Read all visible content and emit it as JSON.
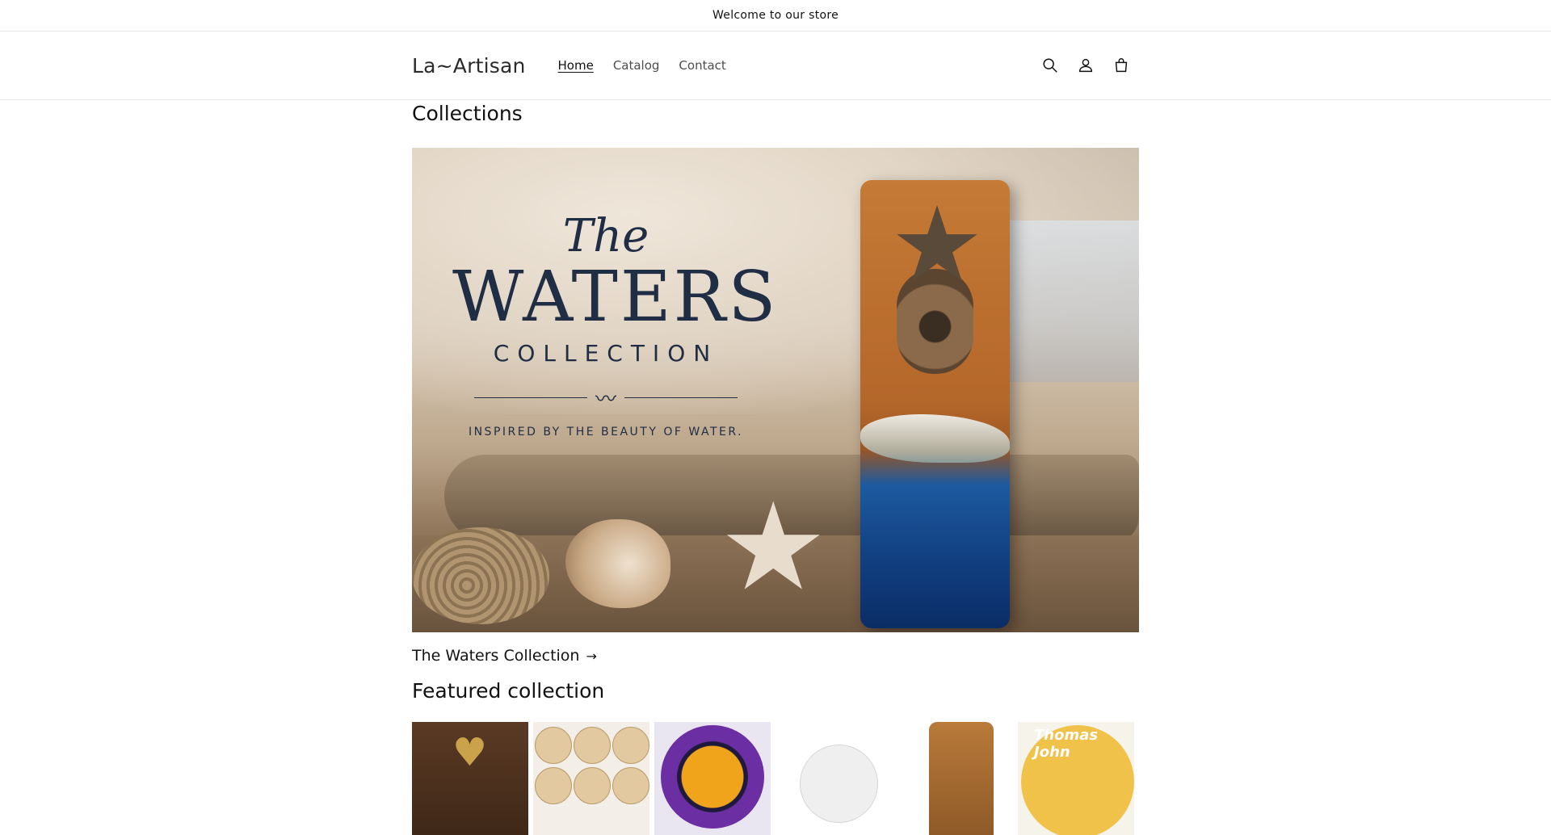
{
  "announcement": {
    "text": "Welcome to our store"
  },
  "header": {
    "logo": "La~Artisan",
    "nav": [
      {
        "label": "Home",
        "active": true
      },
      {
        "label": "Catalog",
        "active": false
      },
      {
        "label": "Contact",
        "active": false
      }
    ],
    "icons": [
      "search-icon",
      "account-icon",
      "cart-icon"
    ]
  },
  "collections": {
    "title": "Collections",
    "hero": {
      "the": "The",
      "waters": "WATERS",
      "collection": "COLLECTION",
      "tagline": "INSPIRED BY THE BEAUTY OF WATER."
    },
    "link_label": "The Waters Collection",
    "link_arrow": "→"
  },
  "featured": {
    "title": "Featured collection",
    "product_6_text": "Thomas John"
  },
  "colors": {
    "text": "#121212",
    "border": "#e8e8e8",
    "hero_ink": "#1f2d45"
  }
}
